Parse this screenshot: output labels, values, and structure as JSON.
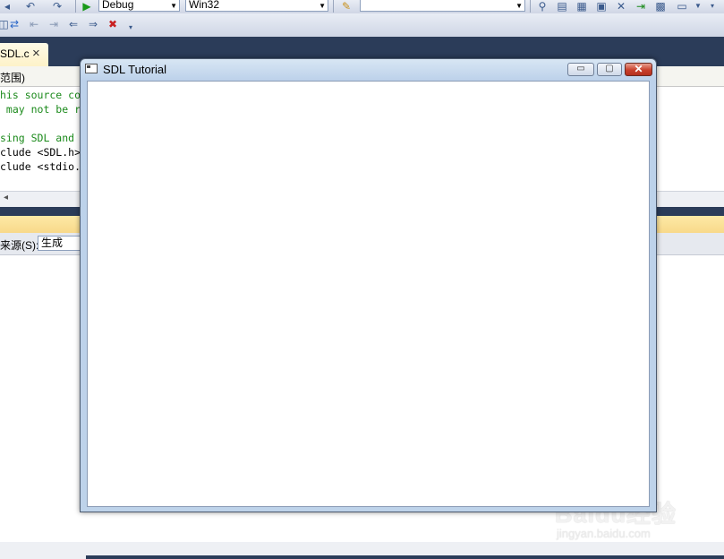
{
  "toolbar": {
    "config_combo": "Debug",
    "platform_combo": "Win32",
    "find_combo": ""
  },
  "editor_tab": {
    "label": "SDL.c",
    "close": "×"
  },
  "scope": {
    "label": "范围)"
  },
  "code": {
    "lines": [
      {
        "text": "his source co",
        "kind": "comment"
      },
      {
        "text": " may not be r",
        "kind": "comment"
      },
      {
        "text": "",
        "kind": "normal"
      },
      {
        "text": "sing SDL and",
        "kind": "comment"
      },
      {
        "text": "clude <SDL.h>",
        "kind": "normal"
      },
      {
        "text": "clude <stdio.",
        "kind": "normal"
      }
    ]
  },
  "output": {
    "source_label": "来源(S):",
    "source_value": "生成"
  },
  "sdl_window": {
    "title": "SDL Tutorial",
    "minimize": "▭",
    "maximize": "▢",
    "close": "✕"
  },
  "watermark": {
    "brand": "Baidu经验",
    "url": "jingyan.baidu.com"
  },
  "icons": {
    "run": "▶",
    "open_folder": "📂"
  }
}
